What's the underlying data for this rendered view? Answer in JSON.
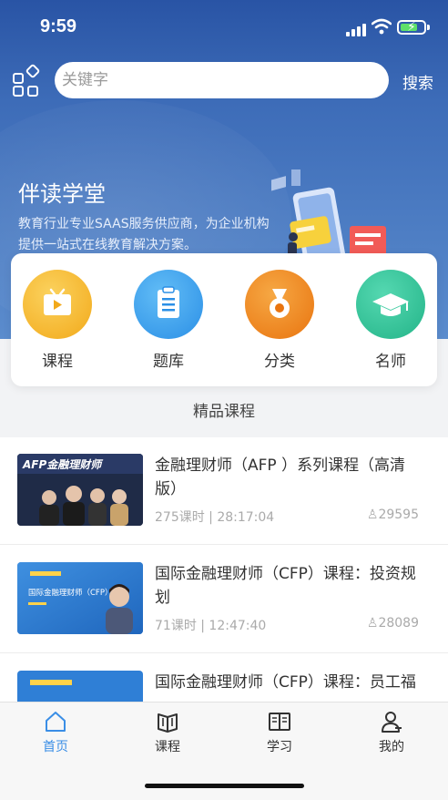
{
  "status": {
    "time": "9:59"
  },
  "search": {
    "placeholder": "关键字",
    "button": "搜索"
  },
  "hero": {
    "title": "伴读学堂",
    "desc": "教育行业专业SAAS服务供应商，为企业机构提供一站式在线教育解决方案。"
  },
  "categories": [
    {
      "label": "课程",
      "icon": "tv-icon",
      "color": "#f5b82e"
    },
    {
      "label": "题库",
      "icon": "clipboard-icon",
      "color": "#3ba3ee"
    },
    {
      "label": "分类",
      "icon": "medal-icon",
      "color": "#f08a1c"
    },
    {
      "label": "名师",
      "icon": "graduation-cap-icon",
      "color": "#2fc59a"
    }
  ],
  "section_title": "精品课程",
  "courses": [
    {
      "title": "金融理财师（AFP ）系列课程（高清版）",
      "meta": "275课时 | 28:17:04",
      "students": "29595",
      "thumb_text": "AFP金融理财师"
    },
    {
      "title": "国际金融理财师（CFP）课程：投资规划",
      "meta": "71课时 | 12:47:40",
      "students": "28089",
      "thumb_text": "国际金融理财师（CFP）"
    },
    {
      "title": "国际金融理财师（CFP）课程：员工福",
      "meta": "",
      "students": "",
      "thumb_text": ""
    }
  ],
  "tabs": [
    {
      "label": "首页",
      "icon": "home-icon",
      "active": true
    },
    {
      "label": "课程",
      "icon": "book-icon",
      "active": false
    },
    {
      "label": "学习",
      "icon": "open-book-icon",
      "active": false
    },
    {
      "label": "我的",
      "icon": "user-icon",
      "active": false
    }
  ],
  "colors": {
    "accent": "#3a8ee6",
    "header_top": "#2954a5",
    "header_bottom": "#5b8ccd"
  }
}
